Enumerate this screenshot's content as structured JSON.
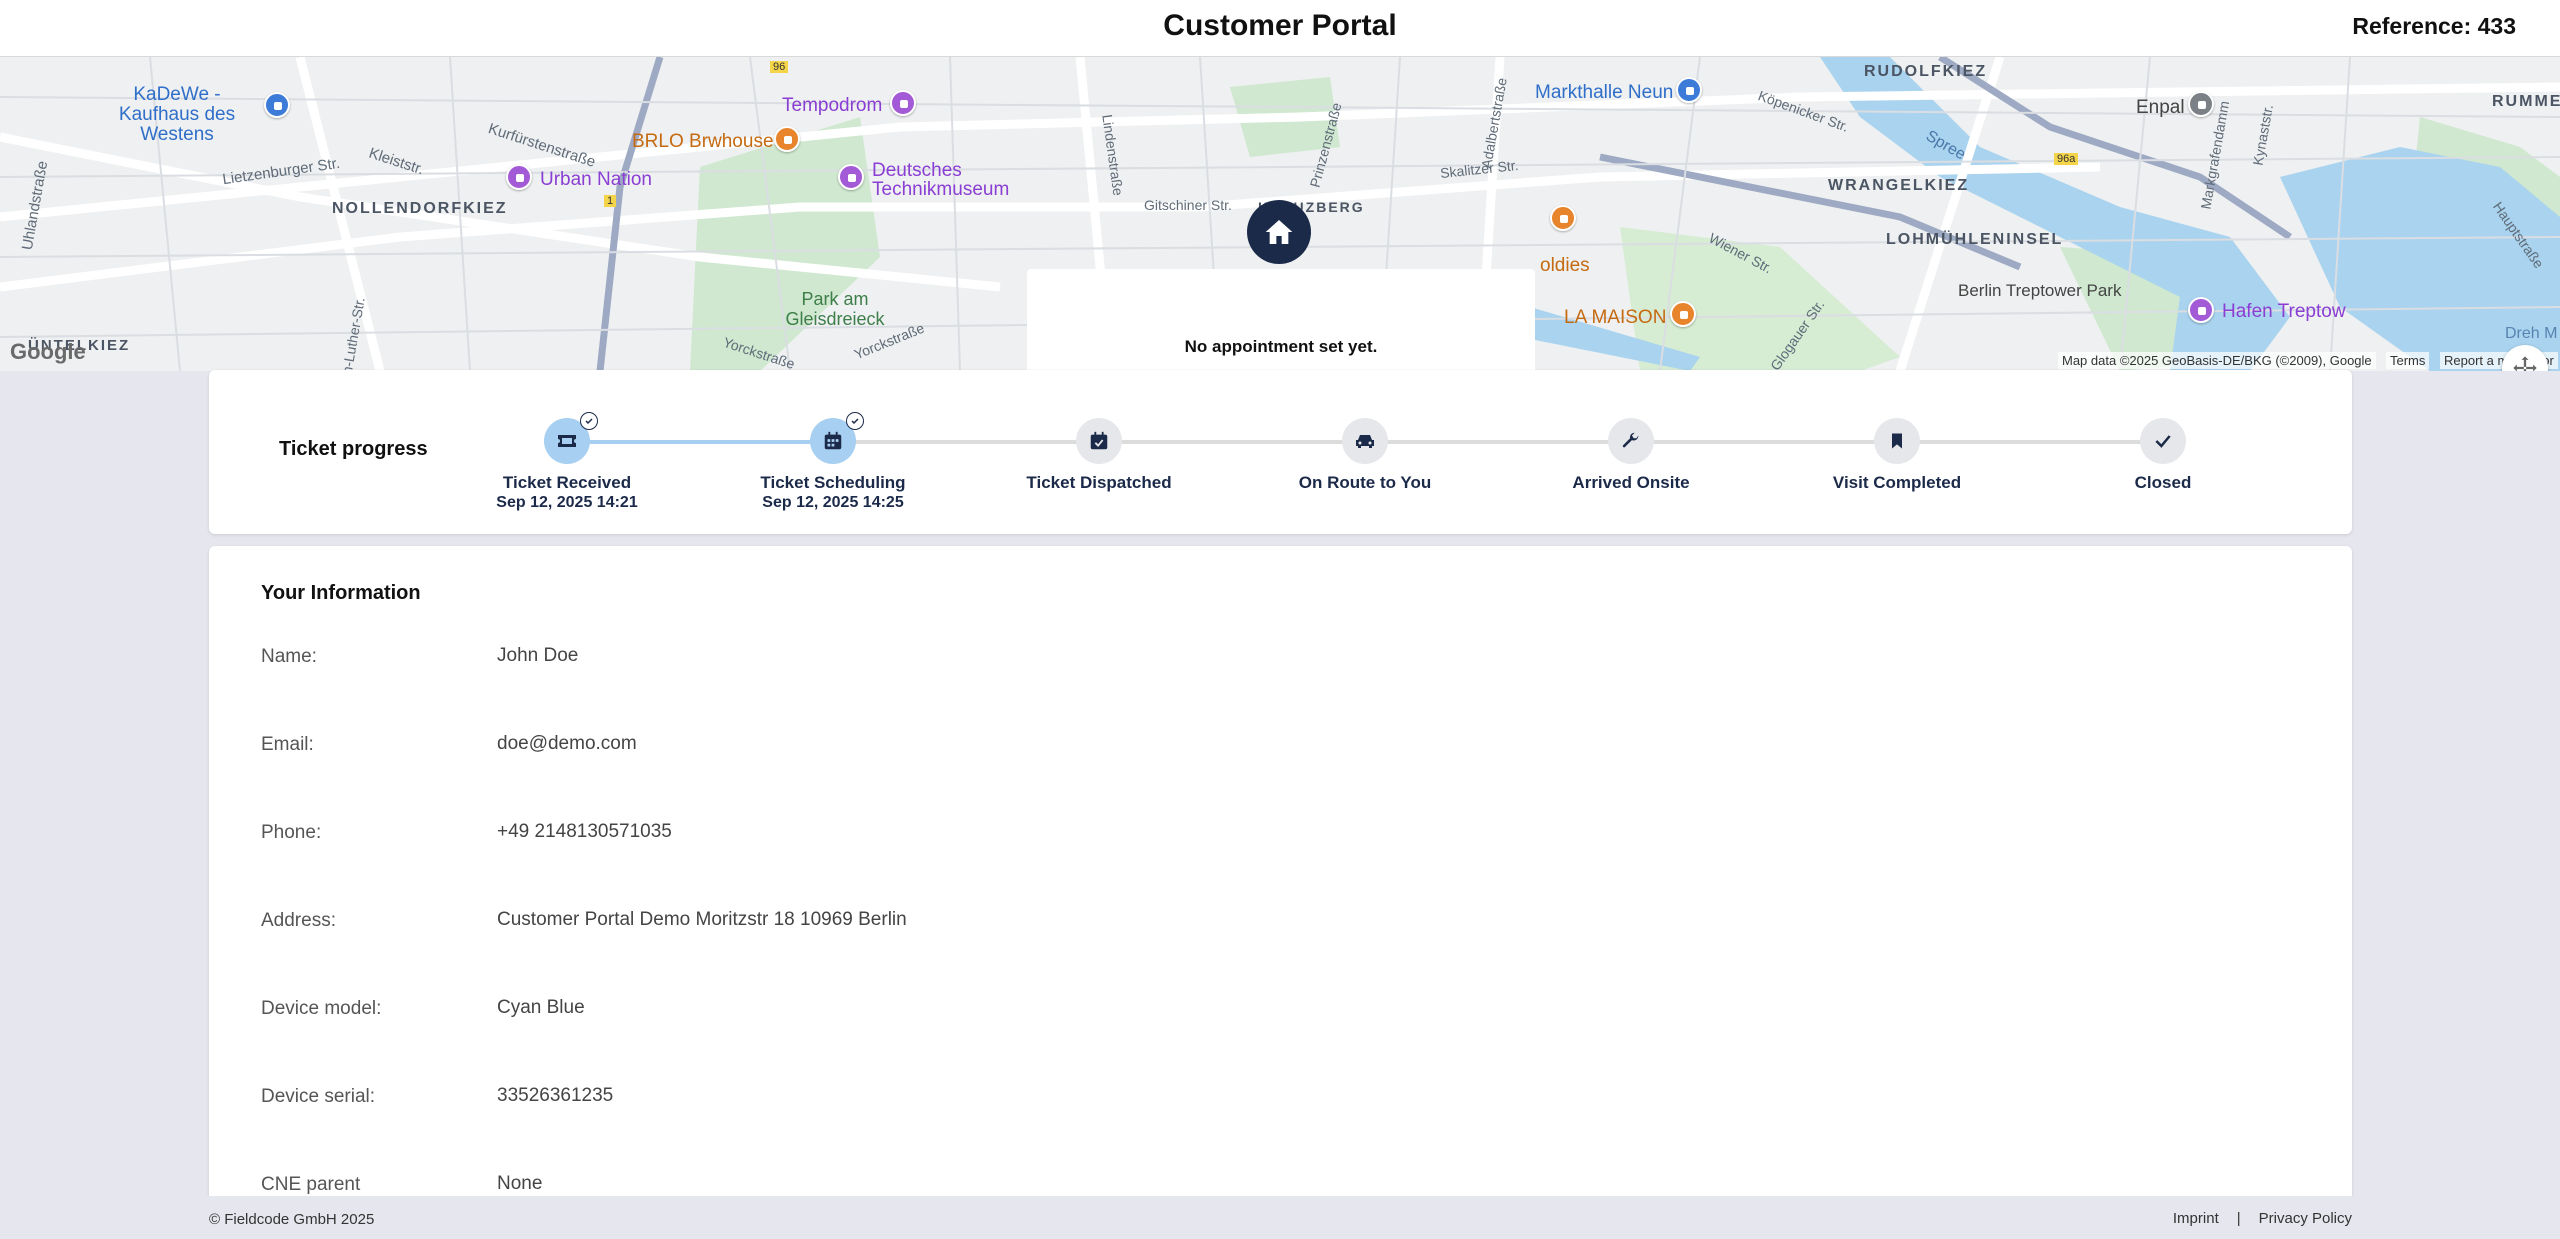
{
  "header": {
    "title": "Customer Portal",
    "reference": "Reference: 433"
  },
  "map": {
    "no_appointment": "No appointment set yet.",
    "attribution": "Map data ©2025 GeoBasis-DE/BKG (©2009), Google",
    "terms": "Terms",
    "report": "Report a map error",
    "google_logo": "Google",
    "labels": {
      "kadewe": "KaDeWe - Kaufhaus des Westens",
      "tempodrom": "Tempodrom",
      "markthalle": "Markthalle Neun",
      "rudolfkiez": "RUDOLFKIEZ",
      "enpal": "Enpal",
      "rummels": "RUMMELS",
      "urban_nation": "Urban Nation",
      "brlo": "BRLO Brwhouse",
      "technikmuseum": "Deutsches Technikmuseum",
      "nollendorfkiez": "NOLLENDORFKIEZ",
      "kreuzberg": "KREUZBERG",
      "wrangelkiez": "WRANGELKIEZ",
      "lohmuehleninsel": "LOHMÜHLENINSEL",
      "park_gleisdreieck": "Park am Gleisdreieck",
      "goldies": "oldies",
      "la_maison": "LA MAISON",
      "treptower_park": "Berlin Treptower Park",
      "hafen_treptow": "Hafen Treptow",
      "gruenkiez": "ÜNTELKIEZ",
      "kurfuerstenstr": "Kurfürstenstraße",
      "kleiststr": "Kleiststr.",
      "lietzenburger": "Lietzenburger Str.",
      "uhlandstr": "Uhlandstraße",
      "gitschiner": "Gitschiner Str.",
      "skalitzer": "Skalitzer Str.",
      "wiener": "Wiener Str.",
      "koepenicker": "Köpenicker Str.",
      "yorckstr": "Yorckstraße",
      "yorckstr2": "Yorckstraße",
      "spree": "Spree",
      "adalbertstr": "Adalbertstraße",
      "lindenstr": "Lindenstraße",
      "prinzenstr": "Prinzenstraße",
      "glogauer": "Glogauer Str.",
      "markgrafendamm": "Markgrafendamm",
      "kynaststr": "Kynaststr.",
      "hauptstr": "Hauptstraße",
      "martin_luther": "Martin-Luther-Str.",
      "road_96": "96",
      "road_96a": "96a",
      "road_1": "1",
      "dreh": "Dreh M"
    }
  },
  "progress": {
    "title": "Ticket progress",
    "steps": [
      {
        "label": "Ticket Received",
        "date": "Sep 12, 2025 14:21",
        "done": true,
        "icon": "ticket-icon"
      },
      {
        "label": "Ticket Scheduling",
        "date": "Sep 12, 2025 14:25",
        "done": true,
        "icon": "calendar-icon"
      },
      {
        "label": "Ticket Dispatched",
        "date": "",
        "done": false,
        "icon": "calendar-check-icon"
      },
      {
        "label": "On Route to You",
        "date": "",
        "done": false,
        "icon": "car-icon"
      },
      {
        "label": "Arrived Onsite",
        "date": "",
        "done": false,
        "icon": "wrench-icon"
      },
      {
        "label": "Visit Completed",
        "date": "",
        "done": false,
        "icon": "bookmark-icon"
      },
      {
        "label": "Closed",
        "date": "",
        "done": false,
        "icon": "check-icon"
      }
    ],
    "completed_fraction": 0.1667
  },
  "info": {
    "title": "Your Information",
    "rows": [
      {
        "key": "Name:",
        "value": "John Doe"
      },
      {
        "key": "Email:",
        "value": "doe@demo.com"
      },
      {
        "key": "Phone:",
        "value": "+49 2148130571035"
      },
      {
        "key": "Address:",
        "value": "Customer Portal Demo Moritzstr 18 10969 Berlin"
      },
      {
        "key": "Device model:",
        "value": "Cyan Blue"
      },
      {
        "key": "Device serial:",
        "value": "33526361235"
      },
      {
        "key": "CNE parent",
        "value": "None"
      }
    ]
  },
  "footer": {
    "copyright": "© Fieldcode GmbH 2025",
    "imprint": "Imprint",
    "separator": "|",
    "privacy": "Privacy Policy"
  },
  "colors": {
    "navy": "#1c2a4a",
    "done_step": "#a7cff1",
    "pending_step": "#e6e7ea",
    "background": "#e6e7ee"
  }
}
